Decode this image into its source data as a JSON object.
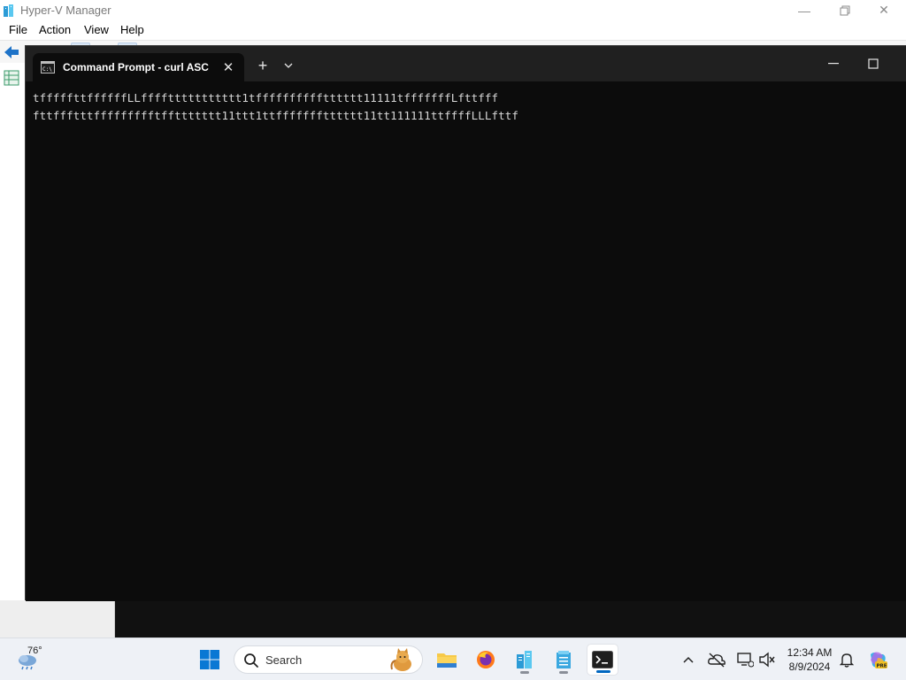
{
  "background_window": {
    "title": "Hyper-V Manager",
    "menu": [
      "File",
      "Action",
      "View",
      "Help"
    ]
  },
  "terminal": {
    "tab_title": "Command Prompt - curl  ASC",
    "lines": [
      "tfffffttffffffLLffffttttttttttt1tfffffffffftttttt11111tfffffffLfttfff",
      "fttffftttffffffffftffttttttt11ttt1ttffffffftttttt11tt111111ttffffLLLfttf"
    ]
  },
  "taskbar": {
    "weather_temp": "76°",
    "search_placeholder": "Search",
    "clock_time": "12:34 AM",
    "clock_date": "8/9/2024"
  },
  "colors": {
    "terminal_bg": "#0c0c0c",
    "terminal_text": "#d8d8d8",
    "tab_bar": "#202020",
    "taskbar_bg": "#eef1f6",
    "accent": "#0067c0"
  }
}
